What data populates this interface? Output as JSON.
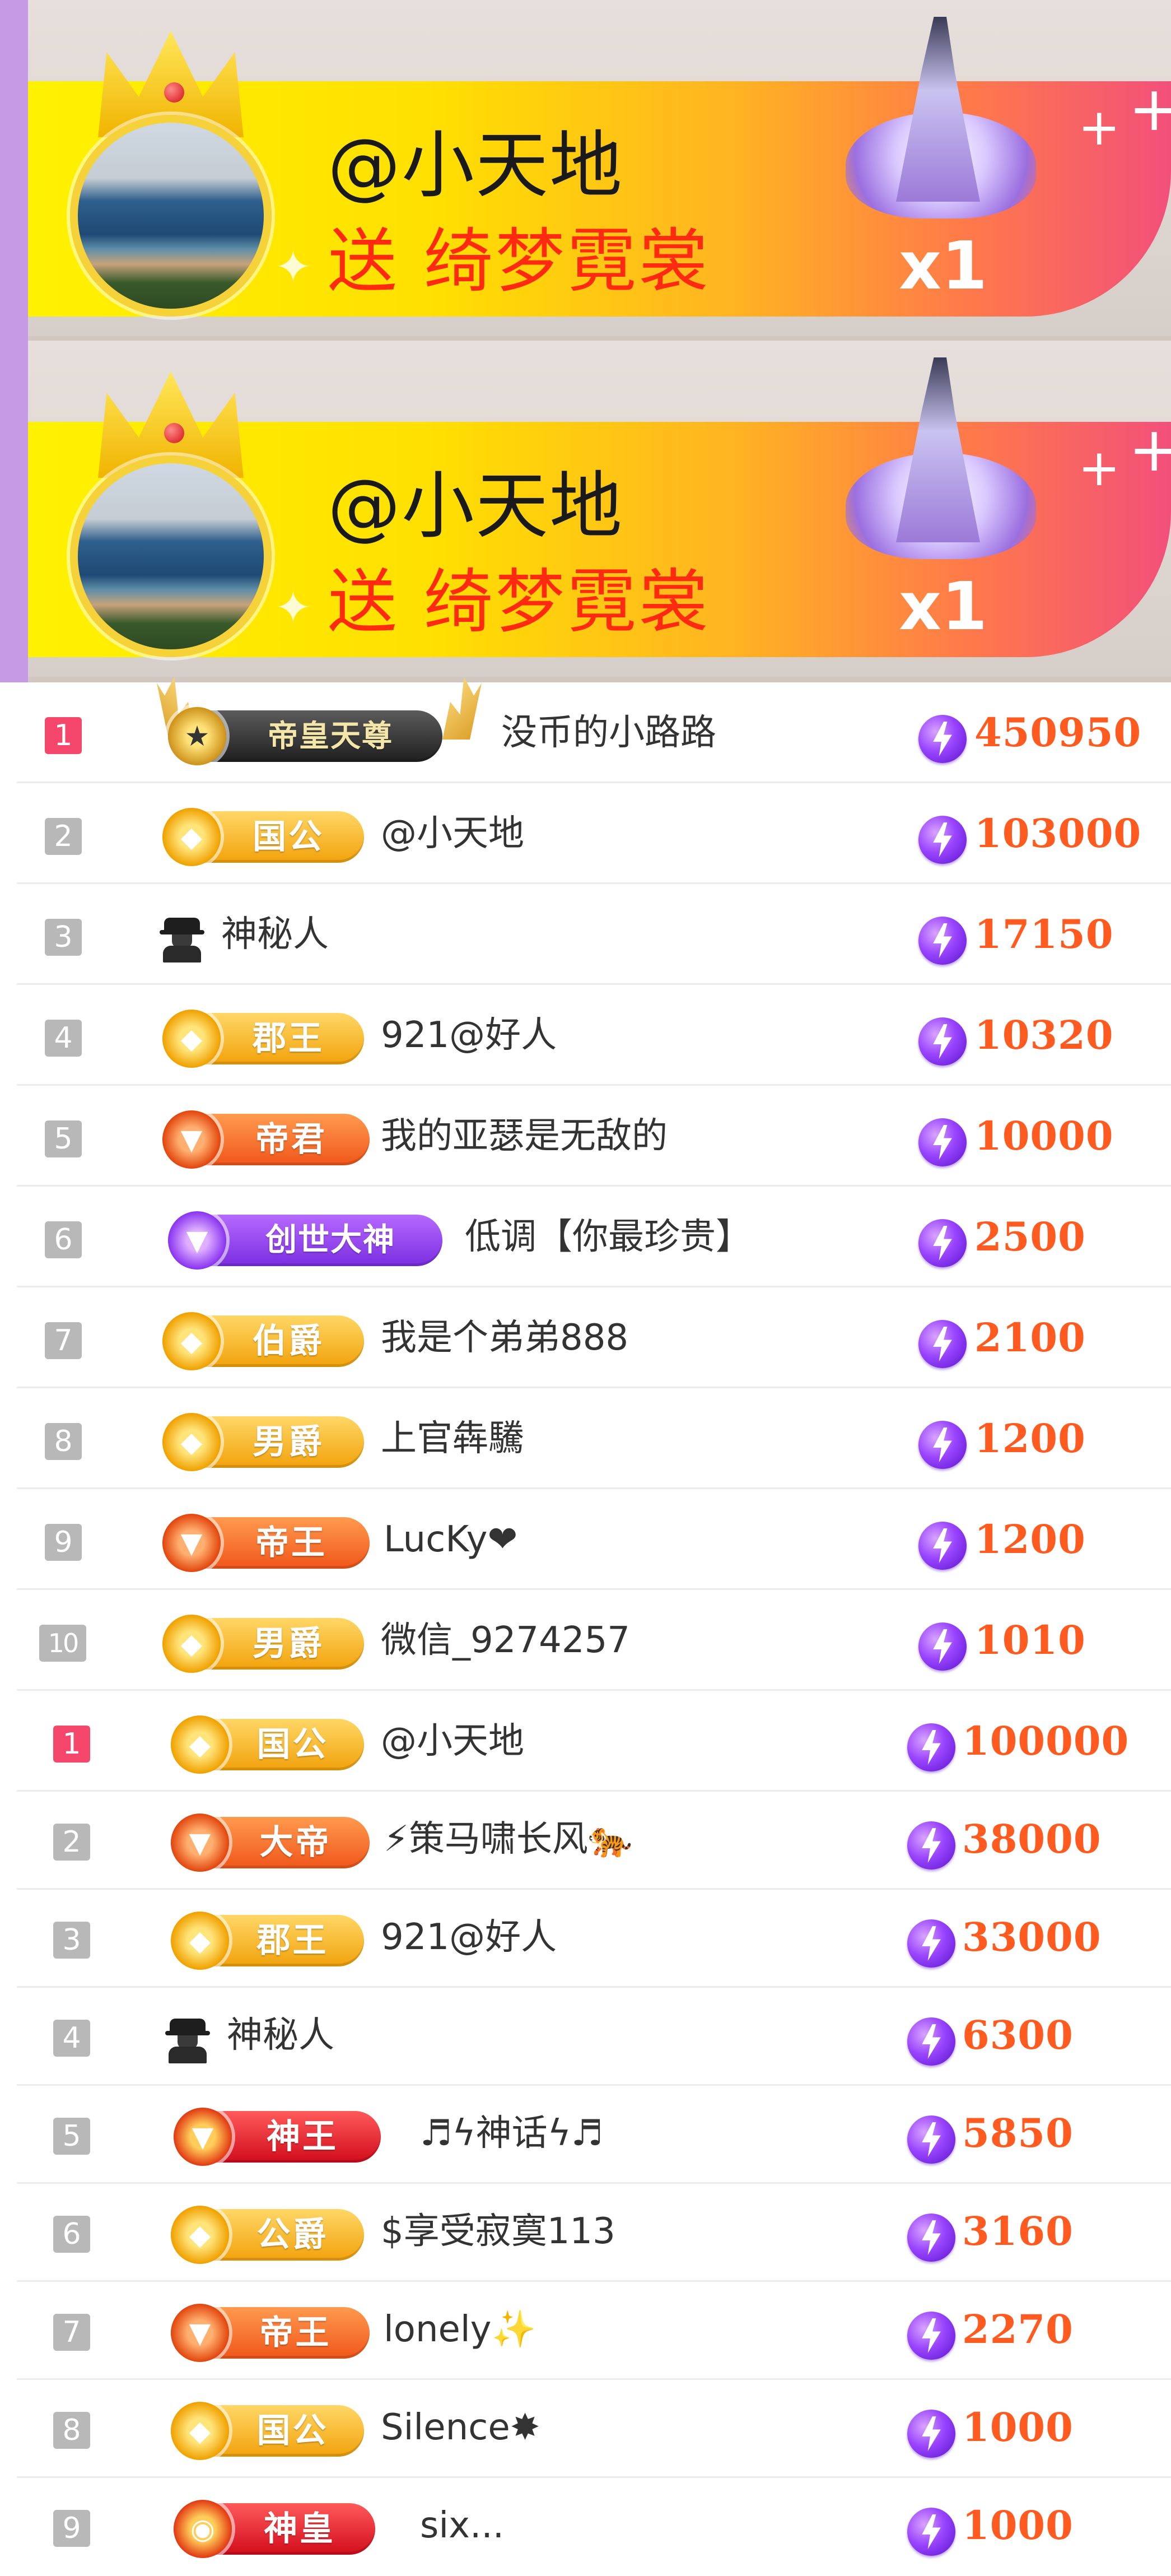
{
  "banners": [
    {
      "sender": "@小天地",
      "gift_text": "送 绮梦霓裳",
      "count": "x1"
    },
    {
      "sender": "@小天地",
      "gift_text": "送 绮梦霓裳",
      "count": "x1"
    }
  ],
  "rankings": [
    [
      {
        "rank": "1",
        "badge": "帝皇天尊",
        "name": "没币的小路路",
        "score": "450950"
      },
      {
        "rank": "2",
        "badge": "国公",
        "name": "@小天地",
        "score": "103000"
      },
      {
        "rank": "3",
        "badge": "",
        "name": "神秘人",
        "score": "17150"
      },
      {
        "rank": "4",
        "badge": "郡王",
        "name": "921@好人",
        "score": "10320"
      },
      {
        "rank": "5",
        "badge": "帝君",
        "name": "我的亚瑟是无敌的",
        "score": "10000"
      },
      {
        "rank": "6",
        "badge": "创世大神",
        "name": "低调【你最珍贵】",
        "score": "2500"
      },
      {
        "rank": "7",
        "badge": "伯爵",
        "name": "我是个弟弟888",
        "score": "2100"
      },
      {
        "rank": "8",
        "badge": "男爵",
        "name": "上官犇驣",
        "score": "1200"
      },
      {
        "rank": "9",
        "badge": "帝王",
        "name": "LucKy❤",
        "score": "1200"
      },
      {
        "rank": "10",
        "badge": "男爵",
        "name": "微信_9274257",
        "score": "1010"
      }
    ],
    [
      {
        "rank": "1",
        "badge": "国公",
        "name": "@小天地",
        "score": "100000"
      },
      {
        "rank": "2",
        "badge": "大帝",
        "name": "⚡策马啸长风🐅",
        "score": "38000"
      },
      {
        "rank": "3",
        "badge": "郡王",
        "name": "921@好人",
        "score": "33000"
      },
      {
        "rank": "4",
        "badge": "",
        "name": "神秘人",
        "score": "6300"
      },
      {
        "rank": "5",
        "badge": "神王",
        "name": "♬ϟ神话ϟ♬",
        "score": "5850"
      },
      {
        "rank": "6",
        "badge": "公爵",
        "name": "$享受寂寞113",
        "score": "3160"
      },
      {
        "rank": "7",
        "badge": "帝王",
        "name": "lonely✨",
        "score": "2270"
      },
      {
        "rank": "8",
        "badge": "国公",
        "name": "Silence✸",
        "score": "1000"
      },
      {
        "rank": "9",
        "badge": "神皇",
        "name": "six...",
        "score": "1000"
      }
    ]
  ]
}
